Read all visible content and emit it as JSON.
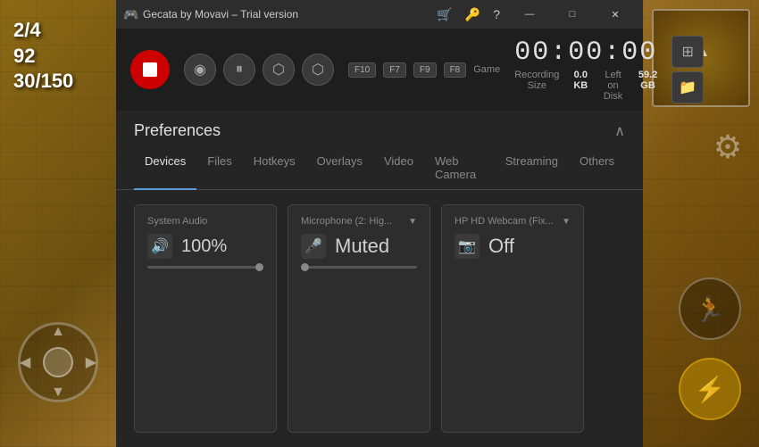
{
  "game": {
    "stats": {
      "ratio": "2/4",
      "score": "92",
      "progress": "30/150"
    }
  },
  "titlebar": {
    "icon": "🎮",
    "text": "Gecata by Movavi – Trial version",
    "min_label": "—",
    "max_label": "□",
    "close_label": "✕"
  },
  "toolbar": {
    "record_title": "Stop Recording",
    "webcam_icon": "((●))",
    "pause_icon": "⏸",
    "screenshot_icon": "⬡",
    "gamepad_icon": "🎮",
    "hotkeys": {
      "f10": "F10",
      "f7": "F7",
      "f9": "F9",
      "f8": "F8"
    },
    "game_label": "Game",
    "timer": "00:00:00",
    "recording_size_label": "Recording Size",
    "recording_size_value": "0.0 KB",
    "left_on_disk_label": "Left on Disk",
    "left_on_disk_value": "59.2 GB"
  },
  "preferences": {
    "title": "Preferences",
    "collapse_icon": "∧",
    "tabs": [
      {
        "id": "devices",
        "label": "Devices",
        "active": true
      },
      {
        "id": "files",
        "label": "Files",
        "active": false
      },
      {
        "id": "hotkeys",
        "label": "Hotkeys",
        "active": false
      },
      {
        "id": "overlays",
        "label": "Overlays",
        "active": false
      },
      {
        "id": "video",
        "label": "Video",
        "active": false
      },
      {
        "id": "webcamera",
        "label": "Web Camera",
        "active": false
      },
      {
        "id": "streaming",
        "label": "Streaming",
        "active": false
      },
      {
        "id": "others",
        "label": "Others",
        "active": false
      }
    ],
    "devices": {
      "system_audio": {
        "name": "System Audio",
        "icon": "🔊",
        "value": "100%",
        "slider_position": "right"
      },
      "microphone": {
        "name": "Microphone (2: Hig...",
        "icon": "🎤",
        "value": "Muted",
        "has_dropdown": true,
        "muted": true
      },
      "webcam": {
        "name": "HP HD Webcam (Fix...",
        "icon": "📷",
        "value": "Off",
        "has_dropdown": true,
        "disabled": true
      }
    }
  }
}
